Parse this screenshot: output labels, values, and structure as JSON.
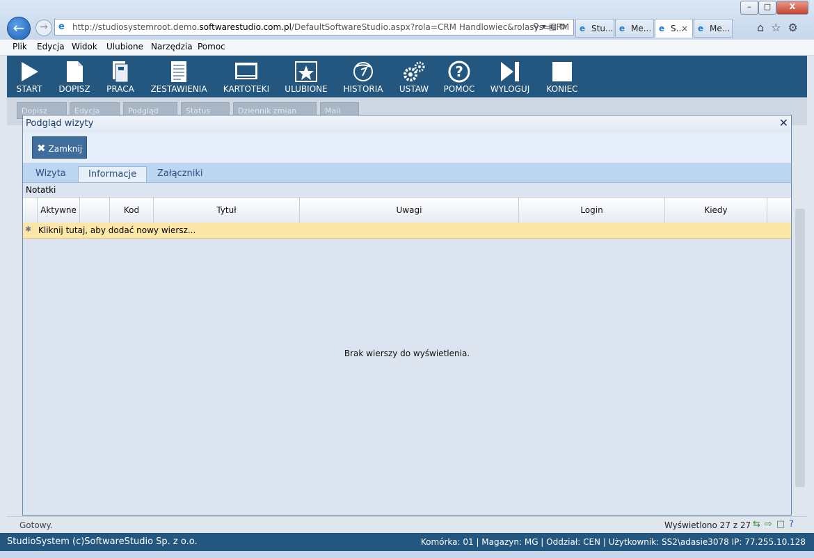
{
  "browser": {
    "url_prefix": "http://studiosystemroot.demo.",
    "url_domain": "softwarestudio.com.pl",
    "url_suffix": "/DefaultSoftwareStudio.aspx?rola=CRM Handlowiec&rolasys=CRM",
    "tabs": [
      {
        "label": "Stu...",
        "active": false
      },
      {
        "label": "Me...",
        "active": false
      },
      {
        "label": "S...",
        "active": true
      },
      {
        "label": "Me...",
        "active": false
      }
    ],
    "window_buttons": [
      "–",
      "□",
      "X"
    ]
  },
  "menu": [
    "Plik",
    "Edycja",
    "Widok",
    "Ulubione",
    "Narzędzia",
    "Pomoc"
  ],
  "toolbar": [
    {
      "label": "START",
      "icon": "play-icon"
    },
    {
      "label": "DOPISZ",
      "icon": "document-icon"
    },
    {
      "label": "PRACA",
      "icon": "binder-icon"
    },
    {
      "label": "ZESTAWIENIA",
      "icon": "report-icon"
    },
    {
      "label": "KARTOTEKI",
      "icon": "monitor-icon"
    },
    {
      "label": "ULUBIONE",
      "icon": "star-icon"
    },
    {
      "label": "HISTORIA",
      "icon": "history-icon"
    },
    {
      "label": "USTAW",
      "icon": "gears-icon"
    },
    {
      "label": "POMOC",
      "icon": "help-icon"
    },
    {
      "label": "WYLOGUJ",
      "icon": "logout-icon"
    },
    {
      "label": "KONIEC",
      "icon": "stop-icon"
    }
  ],
  "background_buttons": [
    "Dopisz",
    "Edycja",
    "Podgląd",
    "Status",
    "Dziennik zmian",
    "Mail"
  ],
  "modal": {
    "title": "Podgląd wizyty",
    "close_button": "Zamknij",
    "tabs": [
      {
        "label": "Wizyta",
        "active": false
      },
      {
        "label": "Informacje",
        "active": true
      },
      {
        "label": "Załączniki",
        "active": false
      }
    ],
    "section_label": "Notatki",
    "grid": {
      "columns": [
        "",
        "Aktywne",
        "",
        "Kod",
        "Tytuł",
        "Uwagi",
        "Login",
        "Kiedy",
        ""
      ],
      "new_row_text": "Kliknij tutaj, aby dodać nowy wiersz...",
      "empty_text": "Brak wierszy do wyświetlenia."
    }
  },
  "status": {
    "text": "Gotowy.",
    "count": "Wyświetlono 27 z 27"
  },
  "footer": {
    "left": "StudioSystem (c)SoftwareStudio Sp. z o.o.",
    "right": "Komórka: 01 | Magazyn: MG | Oddział: CEN | Użytkownik: SS2\\adasie3078 IP: 77.255.10.128"
  },
  "colors": {
    "toolbar_bg": "#24577f",
    "new_row_bg": "#fde7a8",
    "tabstrip_bg": "#bcd6f2"
  }
}
